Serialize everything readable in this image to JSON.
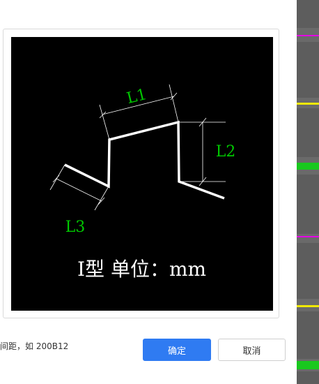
{
  "preview": {
    "dim_labels": [
      "L1",
      "L2",
      "L3"
    ],
    "caption": "I型 单位：mm",
    "colors": {
      "background": "#000000",
      "shape": "#ffffff",
      "dimension_text": "#00c800",
      "caption": "#ffffff"
    }
  },
  "hint": {
    "text": "间距，如 200B12"
  },
  "buttons": {
    "ok_label": "确定",
    "cancel_label": "取消"
  },
  "colors": {
    "accent": "#2f7bf2",
    "bg_green": "#19c81e",
    "bg_magenta": "#e400e4",
    "bg_yellow": "#f0e800"
  }
}
